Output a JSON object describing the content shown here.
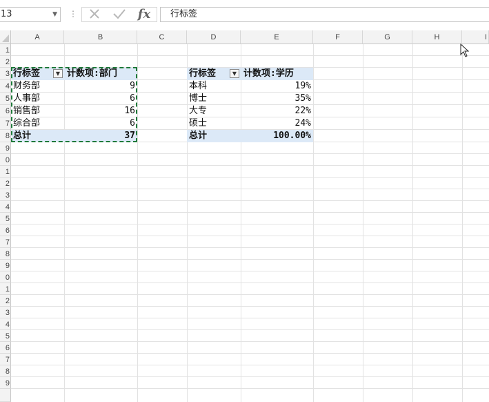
{
  "formula_bar": {
    "name_box": "13",
    "cancel_icon": "x-icon",
    "enter_icon": "check-icon",
    "fx_label": "fx",
    "formula_text": "行标签"
  },
  "columns": [
    "A",
    "B",
    "C",
    "D",
    "E",
    "F",
    "G",
    "H",
    "I"
  ],
  "rows": [
    "1",
    "2",
    "3",
    "4",
    "5",
    "6",
    "7",
    "8",
    "9",
    "0",
    "1",
    "2",
    "3",
    "4",
    "5",
    "6",
    "7",
    "8",
    "9",
    "0",
    "1",
    "2",
    "3",
    "4",
    "5",
    "6",
    "7",
    "8",
    "9"
  ],
  "pivot1": {
    "header_label": "行标签",
    "header_value": "计数项:部门",
    "items": [
      {
        "label": "财务部",
        "value": "9"
      },
      {
        "label": "人事部",
        "value": "6"
      },
      {
        "label": "销售部",
        "value": "16"
      },
      {
        "label": "综合部",
        "value": "6"
      }
    ],
    "total_label": "总计",
    "total_value": "37"
  },
  "pivot2": {
    "header_label": "行标签",
    "header_value": "计数项:学历",
    "items": [
      {
        "label": "本科",
        "value": "19%"
      },
      {
        "label": "博士",
        "value": "35%"
      },
      {
        "label": "大专",
        "value": "22%"
      },
      {
        "label": "硕士",
        "value": "24%"
      }
    ],
    "total_label": "总计",
    "total_value": "100.00%"
  },
  "colors": {
    "pivot_header_fill": "#dce9f7",
    "selection_marquee": "#1f7a3a"
  }
}
